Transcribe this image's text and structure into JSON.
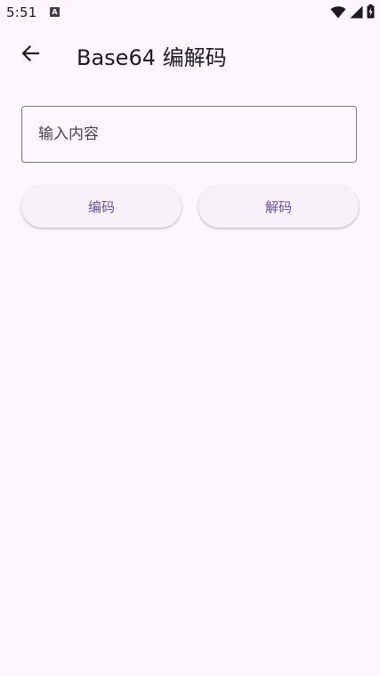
{
  "status_bar": {
    "time": "5:51",
    "notification_icon": "a-letter-icon",
    "icons": [
      "wifi-icon",
      "signal-icon",
      "battery-charging-icon"
    ]
  },
  "app_bar": {
    "back_icon": "arrow-back-icon",
    "title": "Base64 编解码"
  },
  "input": {
    "placeholder": "输入内容",
    "value": ""
  },
  "buttons": {
    "encode_label": "编码",
    "decode_label": "解码"
  },
  "colors": {
    "background": "#fdf7fd",
    "accent": "#6750a4",
    "outline": "#79747e",
    "button_surface": "#f7f2f8"
  }
}
